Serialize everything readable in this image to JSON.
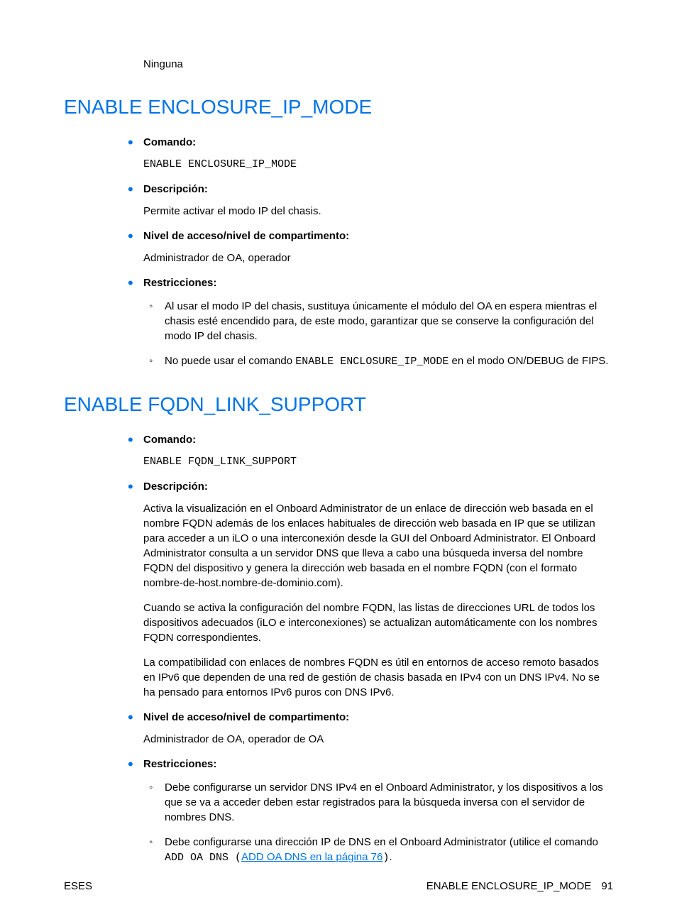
{
  "orphan_text": "Ninguna",
  "section1": {
    "heading": "ENABLE ENCLOSURE_IP_MODE",
    "items": {
      "comando_label": "Comando:",
      "comando_code": "ENABLE ENCLOSURE_IP_MODE",
      "descripcion_label": "Descripción:",
      "descripcion_body": "Permite activar el modo IP del chasis.",
      "nivel_label": "Nivel de acceso/nivel de compartimento:",
      "nivel_body": "Administrador de OA, operador",
      "restricciones_label": "Restricciones:",
      "restr_sub1": "Al usar el modo IP del chasis, sustituya únicamente el módulo del OA en espera mientras el chasis esté encendido para, de este modo, garantizar que se conserve la configuración del modo IP del chasis.",
      "restr_sub2_a": "No puede usar el comando ",
      "restr_sub2_code": "ENABLE ENCLOSURE_IP_MODE",
      "restr_sub2_b": " en el modo ON/DEBUG de FIPS."
    }
  },
  "section2": {
    "heading": "ENABLE FQDN_LINK_SUPPORT",
    "items": {
      "comando_label": "Comando:",
      "comando_code": "ENABLE FQDN_LINK_SUPPORT",
      "descripcion_label": "Descripción:",
      "desc_p1": "Activa la visualización en el Onboard Administrator de un enlace de dirección web basada en el nombre FQDN además de los enlaces habituales de dirección web basada en IP que se utilizan para acceder a un iLO o una interconexión desde la GUI del Onboard Administrator. El Onboard Administrator consulta a un servidor DNS que lleva a cabo una búsqueda inversa del nombre FQDN del dispositivo y genera la dirección web basada en el nombre FQDN (con el formato nombre-de-host.nombre-de-dominio.com).",
      "desc_p2": "Cuando se activa la configuración del nombre FQDN, las listas de direcciones URL de todos los dispositivos adecuados (iLO e interconexiones) se actualizan automáticamente con los nombres FQDN correspondientes.",
      "desc_p3": "La compatibilidad con enlaces de nombres FQDN es útil en entornos de acceso remoto basados en IPv6 que dependen de una red de gestión de chasis basada en IPv4 con un DNS IPv4. No se ha pensado para entornos IPv6 puros con DNS IPv6.",
      "nivel_label": "Nivel de acceso/nivel de compartimento:",
      "nivel_body": "Administrador de OA, operador de OA",
      "restricciones_label": "Restricciones:",
      "restr_sub1": "Debe configurarse un servidor DNS IPv4 en el Onboard Administrator, y los dispositivos a los que se va a acceder deben estar registrados para la búsqueda inversa con el servidor de nombres DNS.",
      "restr_sub2_a": "Debe configurarse una dirección IP de DNS en el Onboard Administrator (utilice el comando ",
      "restr_sub2_code": "ADD OA DNS",
      "restr_sub2_paren_open": " (",
      "restr_sub2_link": "ADD OA DNS en la página 76",
      "restr_sub2_paren_close": ")",
      "restr_sub2_b": "."
    }
  },
  "footer": {
    "left": "ESES",
    "right_title": "ENABLE ENCLOSURE_IP_MODE",
    "page": "91"
  }
}
